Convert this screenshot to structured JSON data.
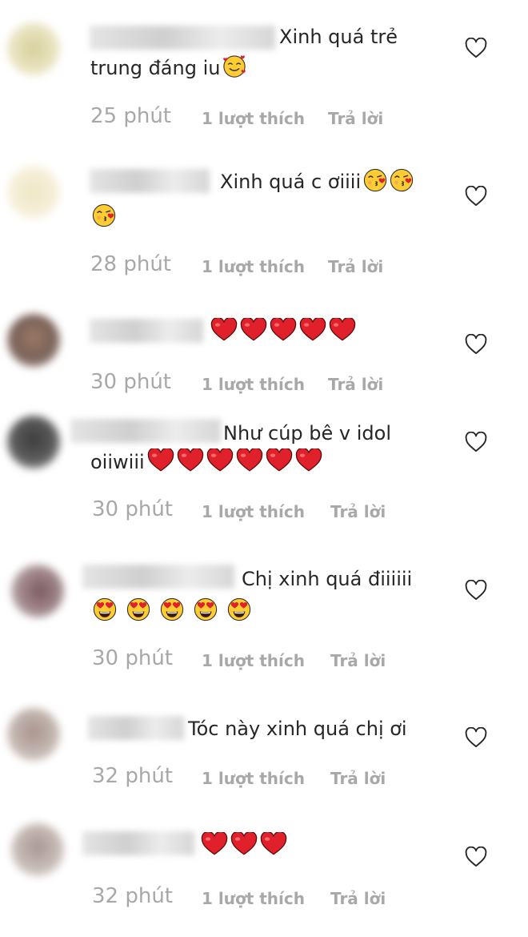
{
  "icons": {
    "like": "heart-outline-icon",
    "smiling_face_with_hearts": "smiling-face-with-hearts-emoji",
    "face_blowing_kiss": "face-blowing-kiss-emoji",
    "red_heart": "red-heart-emoji",
    "heart_eyes": "smiling-face-with-heart-eyes-emoji"
  },
  "colors": {
    "text": "#262626",
    "meta": "#a8a8a8",
    "heart_red": "#e0202b",
    "emoji_yellow": "#ffcc33"
  },
  "comments": [
    {
      "text1": "Xinh quá trẻ",
      "text2": "trung đáng iu",
      "emoji": "smiling_face_with_hearts",
      "time": "25 phút",
      "likes": "1 lượt thích",
      "reply": "Trả lời"
    },
    {
      "text1": "Xinh quá c ơiiii",
      "emoji": "face_blowing_kiss x3",
      "time": "28 phút",
      "likes": "1 lượt thích",
      "reply": "Trả lời"
    },
    {
      "text1": "",
      "emoji": "red_heart x5",
      "time": "30 phút",
      "likes": "1 lượt thích",
      "reply": "Trả lời"
    },
    {
      "text1": "Như cúp bê v idol",
      "text2": "oiiwiii",
      "emoji": "red_heart x6",
      "time": "30 phút",
      "likes": "1 lượt thích",
      "reply": "Trả lời"
    },
    {
      "text1": "Chị xinh quá điiiiii",
      "emoji": "heart_eyes x5",
      "time": "30 phút",
      "likes": "1 lượt thích",
      "reply": "Trả lời"
    },
    {
      "text1": "Tóc này xinh quá chị ơi",
      "time": "32 phút",
      "likes": "1 lượt thích",
      "reply": "Trả lời"
    },
    {
      "text1": "",
      "emoji": "red_heart x3",
      "time": "32 phút",
      "likes": "1 lượt thích",
      "reply": "Trả lời"
    }
  ]
}
